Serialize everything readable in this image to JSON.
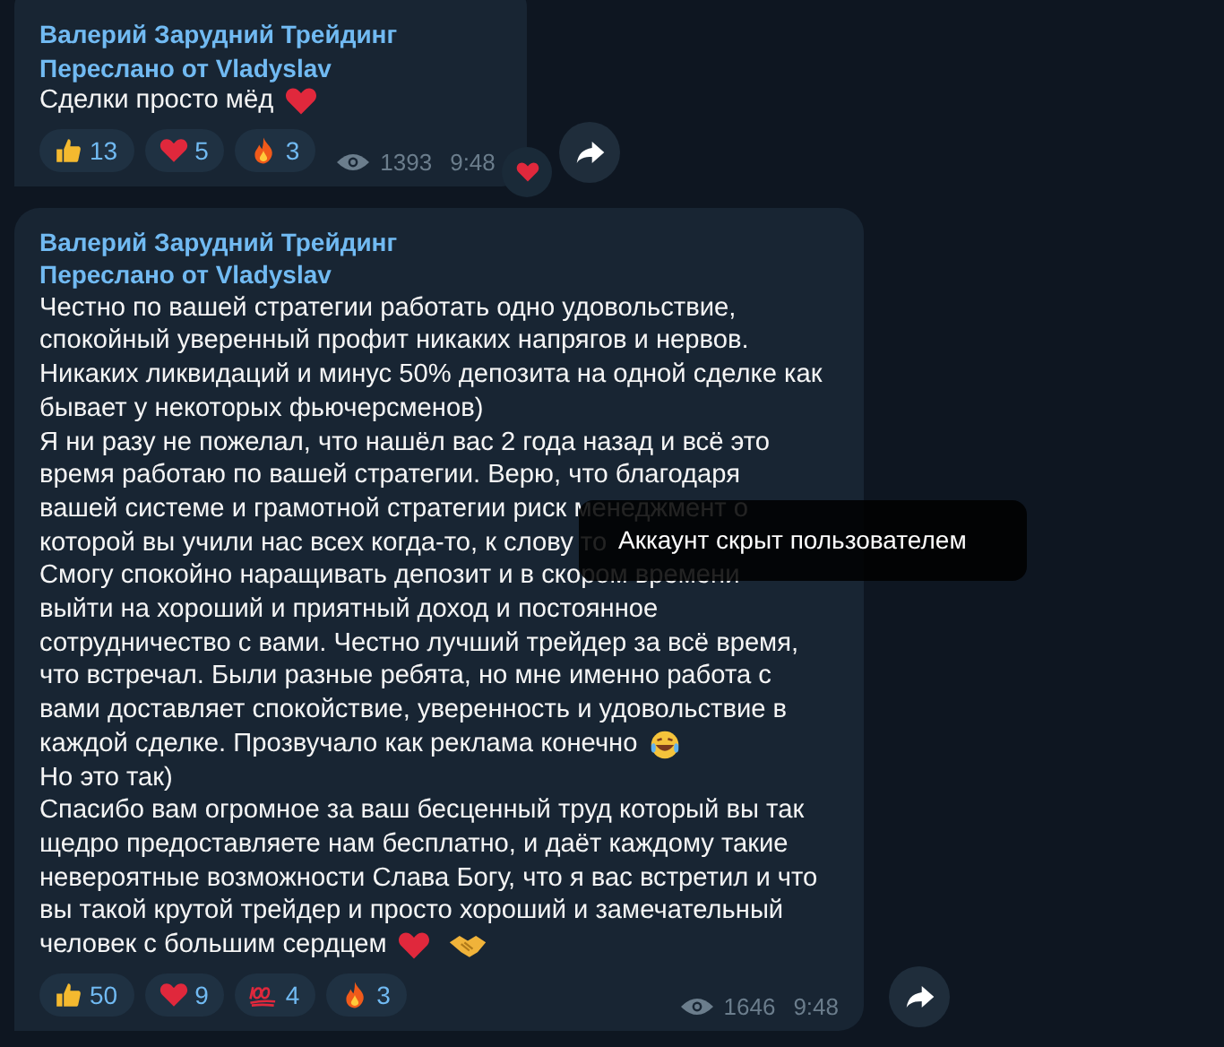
{
  "messages": [
    {
      "channel": "Валерий Зарудний Трейдинг",
      "forwarded": "Переслано от Vladyslav",
      "lines": [
        {
          "text": "Сделки просто мёд",
          "icons": [
            {
              "kind": "heart"
            }
          ]
        }
      ],
      "reactions": [
        {
          "kind": "thumbs-up",
          "count": "13"
        },
        {
          "kind": "heart",
          "count": "5"
        },
        {
          "kind": "fire",
          "count": "3"
        }
      ],
      "views": "1393",
      "time": "9:48",
      "my_reaction": {
        "kind": "heart"
      }
    },
    {
      "channel": "Валерий Зарудний Трейдинг",
      "forwarded": "Переслано от Vladyslav",
      "lines": [
        {
          "text": "Честно по вашей стратегии работать одно удовольствие,"
        },
        {
          "text": "спокойный уверенный профит никаких напрягов и нервов."
        },
        {
          "text": "Никаких ликвидаций и минус 50% депозита на одной сделке как"
        },
        {
          "text": "бывает у некоторых фьючерсменов)"
        },
        {
          "text": "Я ни разу не пожелал, что нашёл вас 2 года назад и всё это"
        },
        {
          "text": "время работаю по вашей стратегии. Верю, что благодаря"
        },
        {
          "text": "вашей системе и грамотной стратегии риск менеджмент о"
        },
        {
          "text": "которой вы учили нас всех когда-то, к слову то"
        },
        {
          "text": "Смогу спокойно наращивать депозит и в скором времени"
        },
        {
          "text": "выйти на хороший и приятный доход и постоянное"
        },
        {
          "text": "сотрудничество с вами. Честно лучший трейдер за всё время,"
        },
        {
          "text": "что встречал. Были разные ребята, но мне именно работа с"
        },
        {
          "text": "вами доставляет спокойствие, уверенность и удовольствие в"
        },
        {
          "text": "каждой сделке. Прозвучало как реклама конечно",
          "icons": [
            {
              "kind": "laugh"
            }
          ]
        },
        {
          "text": "Но это так)"
        },
        {
          "text": "Спасибо вам огромное за ваш бесценный труд который вы так"
        },
        {
          "text": "щедро предоставляете нам бесплатно, и даёт каждому такие"
        },
        {
          "text": "невероятные возможности Слава Богу, что я вас встретил и что"
        },
        {
          "text": "вы такой крутой трейдер и просто хороший и замечательный"
        },
        {
          "text": "человек с большим сердцем",
          "icons": [
            {
              "kind": "heart"
            },
            {
              "kind": "handshake"
            }
          ]
        }
      ],
      "reactions": [
        {
          "kind": "thumbs-up",
          "count": "50"
        },
        {
          "kind": "heart",
          "count": "9"
        },
        {
          "kind": "hundred",
          "count": "4"
        },
        {
          "kind": "fire",
          "count": "3"
        }
      ],
      "views": "1646",
      "time": "9:48"
    }
  ],
  "tooltip": {
    "text": "Аккаунт скрыт пользователем"
  }
}
